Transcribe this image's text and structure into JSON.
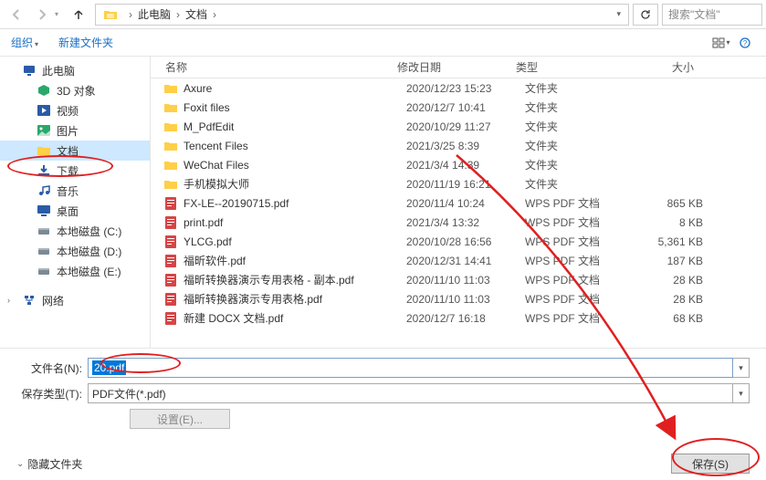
{
  "breadcrumb": [
    "此电脑",
    "文档"
  ],
  "search_placeholder": "搜索\"文档\"",
  "cmdbar": {
    "organize": "组织",
    "new_folder": "新建文件夹"
  },
  "tree": {
    "items": [
      {
        "label": "此电脑",
        "icon": "pc",
        "indent": 0
      },
      {
        "label": "3D 对象",
        "icon": "cube",
        "indent": 1
      },
      {
        "label": "视频",
        "icon": "video",
        "indent": 1
      },
      {
        "label": "图片",
        "icon": "image",
        "indent": 1
      },
      {
        "label": "文档",
        "icon": "folder",
        "indent": 1,
        "selected": true
      },
      {
        "label": "下载",
        "icon": "download",
        "indent": 1
      },
      {
        "label": "音乐",
        "icon": "music",
        "indent": 1
      },
      {
        "label": "桌面",
        "icon": "desktop",
        "indent": 1
      },
      {
        "label": "本地磁盘 (C:)",
        "icon": "disk",
        "indent": 1
      },
      {
        "label": "本地磁盘 (D:)",
        "icon": "disk",
        "indent": 1
      },
      {
        "label": "本地磁盘 (E:)",
        "icon": "disk",
        "indent": 1
      },
      {
        "label": "网络",
        "icon": "network",
        "indent": 0,
        "gap_before": true,
        "expand": true
      }
    ]
  },
  "columns": {
    "name": "名称",
    "date": "修改日期",
    "type": "类型",
    "size": "大小"
  },
  "files": [
    {
      "name": "Axure",
      "date": "2020/12/23 15:23",
      "type": "文件夹",
      "size": "",
      "icon": "folder"
    },
    {
      "name": "Foxit files",
      "date": "2020/12/7 10:41",
      "type": "文件夹",
      "size": "",
      "icon": "folder"
    },
    {
      "name": "M_PdfEdit",
      "date": "2020/10/29 11:27",
      "type": "文件夹",
      "size": "",
      "icon": "folder"
    },
    {
      "name": "Tencent Files",
      "date": "2021/3/25 8:39",
      "type": "文件夹",
      "size": "",
      "icon": "folder"
    },
    {
      "name": "WeChat Files",
      "date": "2021/3/4 14:39",
      "type": "文件夹",
      "size": "",
      "icon": "folder"
    },
    {
      "name": "手机模拟大师",
      "date": "2020/11/19 16:21",
      "type": "文件夹",
      "size": "",
      "icon": "folder"
    },
    {
      "name": "FX-LE--20190715.pdf",
      "date": "2020/11/4 10:24",
      "type": "WPS PDF 文档",
      "size": "865 KB",
      "icon": "pdf"
    },
    {
      "name": "print.pdf",
      "date": "2021/3/4 13:32",
      "type": "WPS PDF 文档",
      "size": "8 KB",
      "icon": "pdf"
    },
    {
      "name": "YLCG.pdf",
      "date": "2020/10/28 16:56",
      "type": "WPS PDF 文档",
      "size": "5,361 KB",
      "icon": "pdf"
    },
    {
      "name": "福昕软件.pdf",
      "date": "2020/12/31 14:41",
      "type": "WPS PDF 文档",
      "size": "187 KB",
      "icon": "pdf"
    },
    {
      "name": "福昕转换器演示专用表格 - 副本.pdf",
      "date": "2020/11/10 11:03",
      "type": "WPS PDF 文档",
      "size": "28 KB",
      "icon": "pdf"
    },
    {
      "name": "福昕转换器演示专用表格.pdf",
      "date": "2020/11/10 11:03",
      "type": "WPS PDF 文档",
      "size": "28 KB",
      "icon": "pdf"
    },
    {
      "name": "新建 DOCX 文档.pdf",
      "date": "2020/12/7 16:18",
      "type": "WPS PDF 文档",
      "size": "68 KB",
      "icon": "pdf"
    }
  ],
  "filename_label": "文件名(N):",
  "filename_value": "20.pdf",
  "filetype_label": "保存类型(T):",
  "filetype_value": "PDF文件(*.pdf)",
  "settings_label": "设置(E)...",
  "hide_folders": "隐藏文件夹",
  "save_label": "保存(S)"
}
